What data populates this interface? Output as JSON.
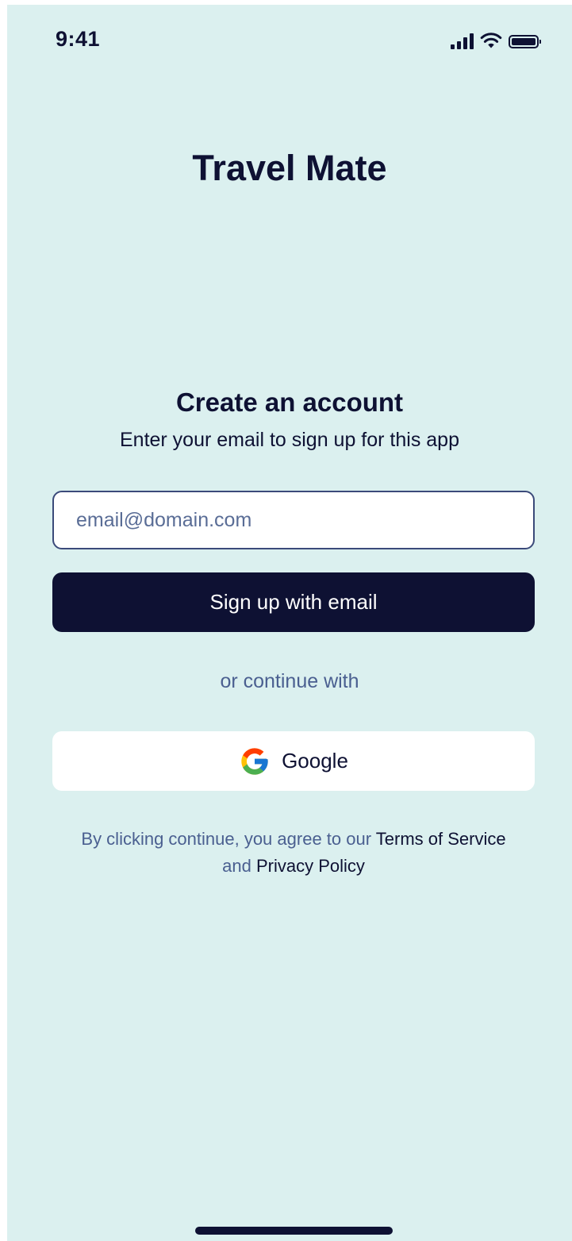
{
  "status_bar": {
    "time": "9:41",
    "icons": [
      "cellular-signal-icon",
      "wifi-icon",
      "battery-icon"
    ]
  },
  "app": {
    "title": "Travel Mate"
  },
  "signup": {
    "title": "Create an account",
    "subtitle": "Enter your email to sign up for this app",
    "email_placeholder": "email@domain.com",
    "email_value": "",
    "submit_label": "Sign up with email",
    "divider_text": "or continue with",
    "google_label": "Google"
  },
  "legal": {
    "prefix": "By clicking continue, you agree to our",
    "terms_link": "Terms of Service",
    "conjunction": "and",
    "privacy_link": "Privacy Policy"
  },
  "colors": {
    "background": "#dbf0ef",
    "primary": "#0e1133",
    "muted_text": "#4a5f90",
    "surface": "#ffffff"
  }
}
